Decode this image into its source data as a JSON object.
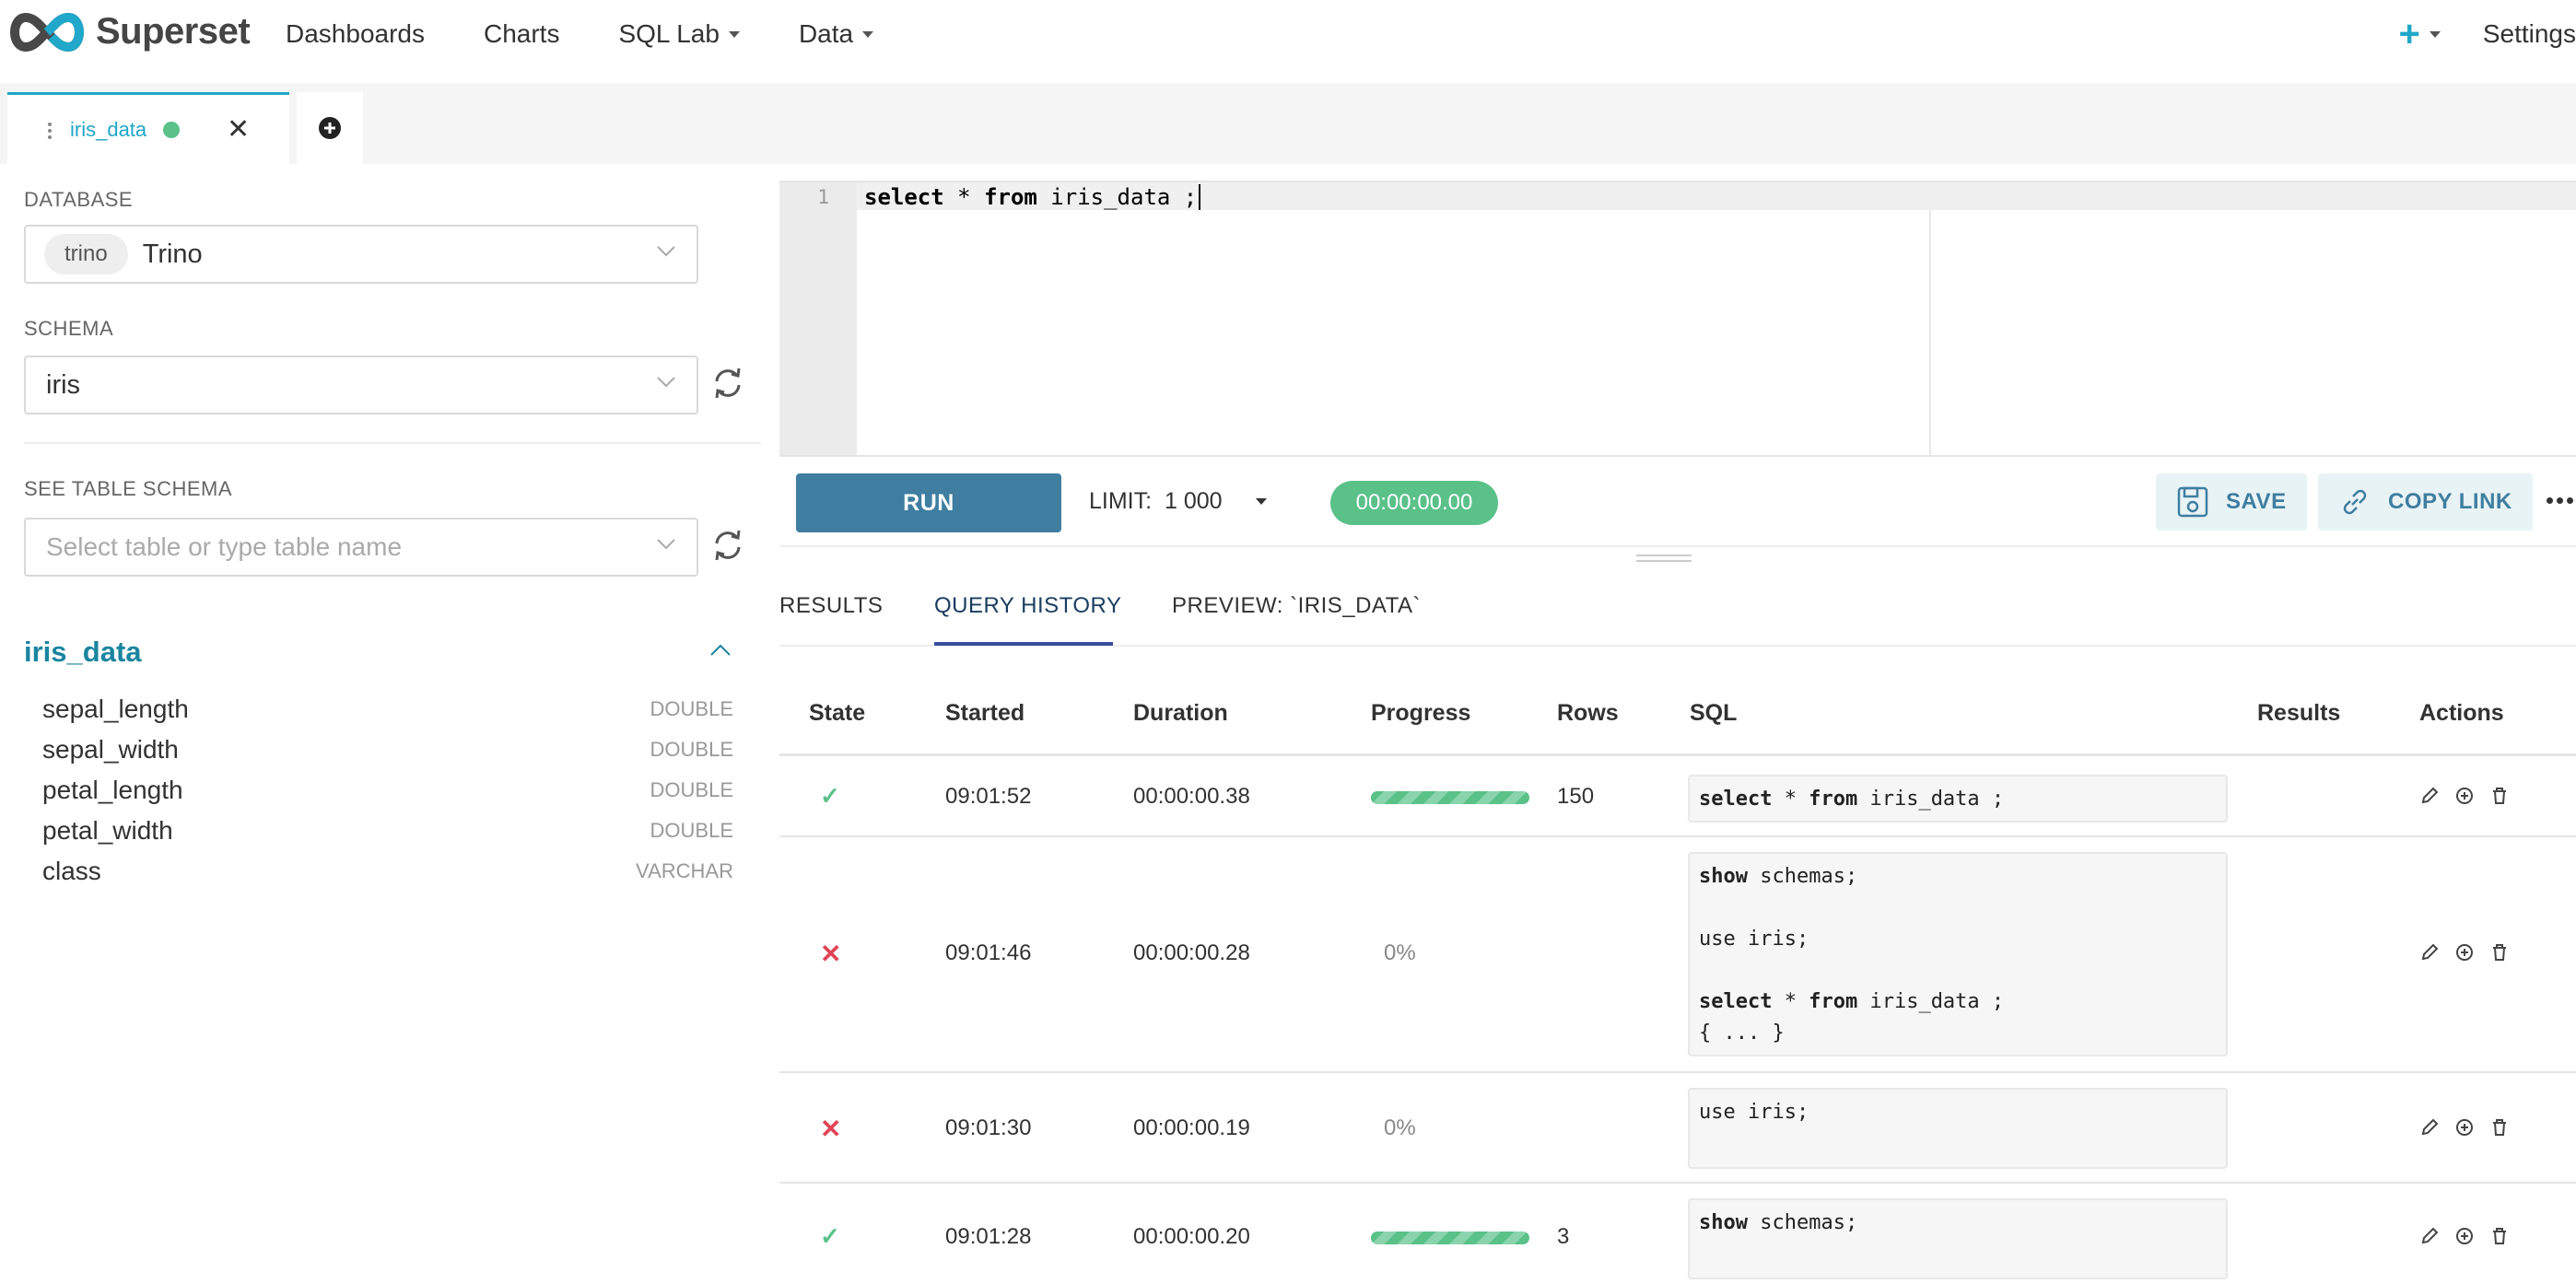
{
  "navbar": {
    "brand": "Superset",
    "menu": [
      "Dashboards",
      "Charts",
      "SQL Lab",
      "Data"
    ],
    "menu_has_caret": [
      false,
      false,
      true,
      true
    ],
    "plus": "+",
    "settings": "Settings"
  },
  "tabs": {
    "active_tab": "iris_data",
    "status": "success"
  },
  "left": {
    "database_label": "DATABASE",
    "database_tag": "trino",
    "database_value": "Trino",
    "schema_label": "SCHEMA",
    "schema_value": "iris",
    "table_schema_label": "SEE TABLE SCHEMA",
    "table_placeholder": "Select table or type table name",
    "table_name": "iris_data",
    "columns": [
      {
        "name": "sepal_length",
        "type": "DOUBLE"
      },
      {
        "name": "sepal_width",
        "type": "DOUBLE"
      },
      {
        "name": "petal_length",
        "type": "DOUBLE"
      },
      {
        "name": "petal_width",
        "type": "DOUBLE"
      },
      {
        "name": "class",
        "type": "VARCHAR"
      }
    ]
  },
  "editor": {
    "line_number": "1",
    "kw1": "select",
    "star": " * ",
    "kw2": "from",
    "rest": " iris_data ;"
  },
  "toolbar": {
    "run": "RUN",
    "limit_label": "LIMIT:",
    "limit_value": "1 000",
    "timer": "00:00:00.00",
    "save": "SAVE",
    "copy_link": "COPY LINK"
  },
  "result_tabs": [
    "RESULTS",
    "QUERY HISTORY",
    "PREVIEW: `IRIS_DATA`"
  ],
  "history": {
    "headers": [
      "State",
      "Started",
      "Duration",
      "Progress",
      "Rows",
      "SQL",
      "Results",
      "Actions"
    ],
    "rows": [
      {
        "state": "success",
        "started": "09:01:52",
        "duration": "00:00:00.38",
        "progress": 1.0,
        "progress_text": "",
        "rows": "150",
        "sql": [
          "select * from iris_data ;"
        ]
      },
      {
        "state": "failed",
        "started": "09:01:46",
        "duration": "00:00:00.28",
        "progress": 0,
        "progress_text": "0%",
        "rows": "",
        "sql": [
          "show schemas;",
          "",
          "use iris;",
          "",
          "select * from iris_data ;",
          "{ ... }"
        ]
      },
      {
        "state": "failed",
        "started": "09:01:30",
        "duration": "00:00:00.19",
        "progress": 0,
        "progress_text": "0%",
        "rows": "",
        "sql": [
          "use iris;",
          ""
        ]
      },
      {
        "state": "success",
        "started": "09:01:28",
        "duration": "00:00:00.20",
        "progress": 1.0,
        "progress_text": "",
        "rows": "3",
        "sql": [
          "show schemas;",
          ""
        ]
      }
    ]
  },
  "icons": {
    "state_success": "check-icon",
    "state_failed": "cross-icon",
    "edit": "pencil-icon",
    "open": "plus-circle-icon",
    "delete": "trash-icon"
  },
  "colors": {
    "accent": "#20a7c9",
    "run_button": "#3f7ea0",
    "success": "#5ac189",
    "failure": "#e04355"
  }
}
